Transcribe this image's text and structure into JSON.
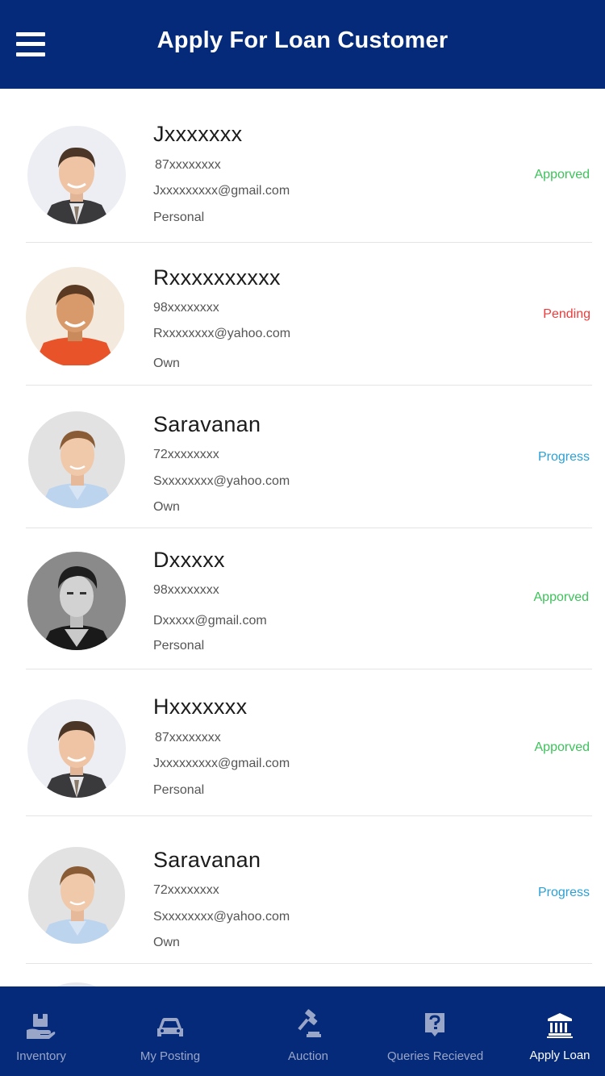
{
  "header": {
    "title": "Apply For Loan Customer",
    "menu_icon": "hamburger-menu-icon"
  },
  "colors": {
    "header_bg": "#052a7a",
    "approved": "#3cc35a",
    "pending": "#ee3b3b",
    "progress": "#2aa0d6"
  },
  "customers": [
    {
      "name": "Jxxxxxxx",
      "phone": "87xxxxxxxx",
      "email": "Jxxxxxxxxx@gmail.com",
      "type": "Personal",
      "status": "Apporved"
    },
    {
      "name": "Rxxxxxxxxxx",
      "phone": "98xxxxxxxx",
      "email": "Rxxxxxxxx@yahoo.com",
      "type": "Own",
      "status": "Pending"
    },
    {
      "name": "Saravanan",
      "phone": "72xxxxxxxx",
      "email": "Sxxxxxxxx@yahoo.com",
      "type": "Own",
      "status": "Progress"
    },
    {
      "name": "Dxxxxx",
      "phone": "98xxxxxxxx",
      "email": "Dxxxxx@gmail.com",
      "type": "Personal",
      "status": "Apporved"
    },
    {
      "name": "Hxxxxxxx",
      "phone": "87xxxxxxxx",
      "email": "Jxxxxxxxxx@gmail.com",
      "type": "Personal",
      "status": "Apporved"
    },
    {
      "name": "Saravanan",
      "phone": "72xxxxxxxx",
      "email": "Sxxxxxxxx@yahoo.com",
      "type": "Own",
      "status": "Progress"
    }
  ],
  "bottom_nav": [
    {
      "label": "Inventory",
      "icon": "inventory-box-icon",
      "active": false
    },
    {
      "label": "My Posting",
      "icon": "car-icon",
      "active": false
    },
    {
      "label": "Auction",
      "icon": "gavel-icon",
      "active": false
    },
    {
      "label": "Queries Recieved",
      "icon": "question-icon",
      "active": false
    },
    {
      "label": "Apply Loan",
      "icon": "bank-icon",
      "active": true
    }
  ]
}
